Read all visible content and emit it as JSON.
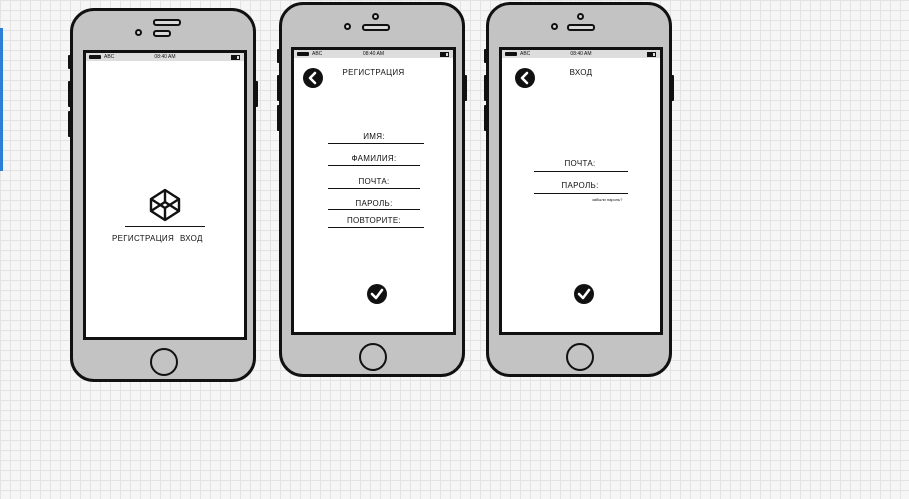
{
  "status_bar": {
    "carrier": "ABC",
    "time": "08:40 AM"
  },
  "screen1": {
    "register_label": "РЕГИСТРАЦИЯ",
    "login_label": "ВХОД"
  },
  "screen2": {
    "title": "РЕГИСТРАЦИЯ",
    "fields": [
      "ИМЯ:",
      "ФАМИЛИЯ:",
      "ПОЧТА:",
      "ПАРОЛЬ:",
      "ПОВТОРИТЕ:"
    ]
  },
  "screen3": {
    "title": "ВХОД",
    "fields": [
      "ПОЧТА:",
      "ПАРОЛЬ:"
    ],
    "forgot": "забыли пароль?"
  }
}
